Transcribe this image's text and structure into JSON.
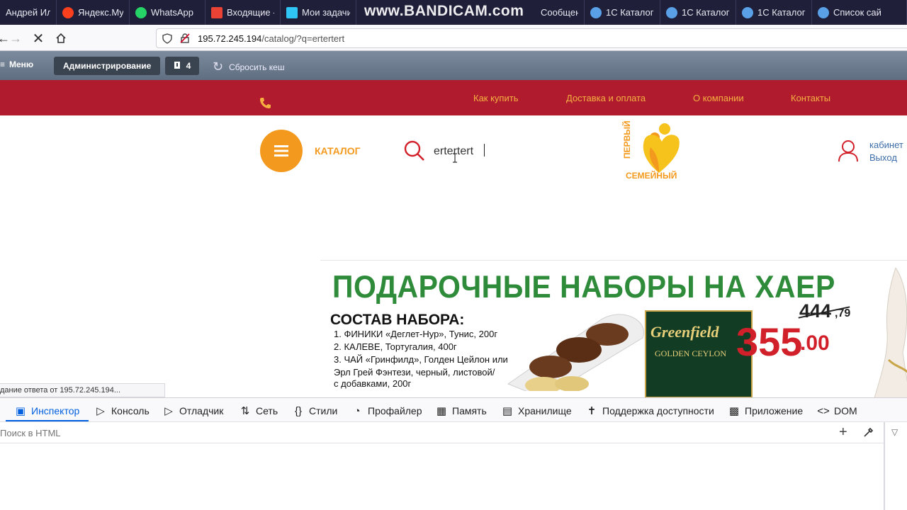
{
  "tabs": [
    {
      "label": "Андрей Ил",
      "color": "#3a3a5a"
    },
    {
      "label": "Яндекс.Муз",
      "color": "#fc3f1d"
    },
    {
      "label": "WhatsApp",
      "color": "#25d366"
    },
    {
      "label": "Входящие -",
      "color": "#ea4335"
    },
    {
      "label": "Мои задачи",
      "color": "#2fc6f6"
    },
    {
      "label": "Сообщения",
      "color": "#2fc6f6"
    },
    {
      "label": "1С Каталог",
      "color": "#5aa0e6"
    },
    {
      "label": "1С Каталог",
      "color": "#5aa0e6"
    },
    {
      "label": "1С Каталог",
      "color": "#5aa0e6"
    },
    {
      "label": "Список сай",
      "color": "#5aa0e6"
    }
  ],
  "watermark": "www.BANDICAM.com",
  "address": {
    "host": "195.72.245.194",
    "path": "/catalog/?q=ertertert"
  },
  "admin": {
    "menu_label": "Меню",
    "admin_label": "Администрирование",
    "notif_count": "4",
    "cache_label": "Сбросить кеш"
  },
  "site_nav": {
    "links": [
      "Как купить",
      "Доставка и оплата",
      "О компании",
      "Контакты"
    ]
  },
  "header": {
    "catalog_label": "КАТАЛОГ",
    "search_value": "ertertert",
    "logo_top": "ПЕРВЫЙ",
    "logo_bottom": "СЕМЕЙНЫЙ",
    "cabinet_label": "кабинет",
    "logout_label": "Выход"
  },
  "banner": {
    "title": "ПОДАРОЧНЫЕ НАБОРЫ НА ХАЕР",
    "subtitle": "СОСТАВ НАБОРА:",
    "items": [
      "1. ФИНИКИ «Деглет-Нур», Тунис, 200г",
      "2. КАЛЕВЕ, Тортугалия, 400г",
      "3. ЧАЙ «Гринфилд», Голден Цейлон или",
      "Эрл Грей Фэнтези, черный, листовой/",
      "с добавками, 200г"
    ],
    "tea_brand": "Greenfield",
    "tea_type": "GOLDEN CEYLON",
    "old_price": "444",
    "old_price_cents": ",79",
    "new_price": "355",
    "new_price_cents": ".00"
  },
  "status_text": "дание ответа от 195.72.245.194...",
  "devtools": {
    "tabs": [
      "Инспектор",
      "Консоль",
      "Отладчик",
      "Сеть",
      "Стили",
      "Профайлер",
      "Память",
      "Хранилище",
      "Поддержка доступности",
      "Приложение",
      "DOM"
    ],
    "search_placeholder": "Поиск в HTML"
  }
}
